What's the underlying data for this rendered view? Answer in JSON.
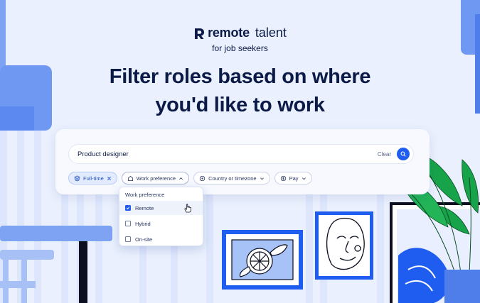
{
  "brand": {
    "name_bold": "remote",
    "name_light": "talent",
    "tagline": "for job seekers"
  },
  "headline": {
    "line1": "Filter roles based on where",
    "line2": "you'd like to work"
  },
  "search": {
    "value": "Product designer",
    "clear_label": "Clear",
    "icon": "search-icon"
  },
  "filters": {
    "full_time": "Full-time",
    "work_preference": "Work preference",
    "country": "Country or timezone",
    "pay": "Pay"
  },
  "dropdown": {
    "title": "Work preference",
    "options": [
      {
        "label": "Remote",
        "checked": true
      },
      {
        "label": "Hybrid",
        "checked": false
      },
      {
        "label": "On-site",
        "checked": false
      }
    ]
  },
  "colors": {
    "accent": "#1f5cf0",
    "text": "#0b1a47",
    "background": "#eaf0fd"
  }
}
